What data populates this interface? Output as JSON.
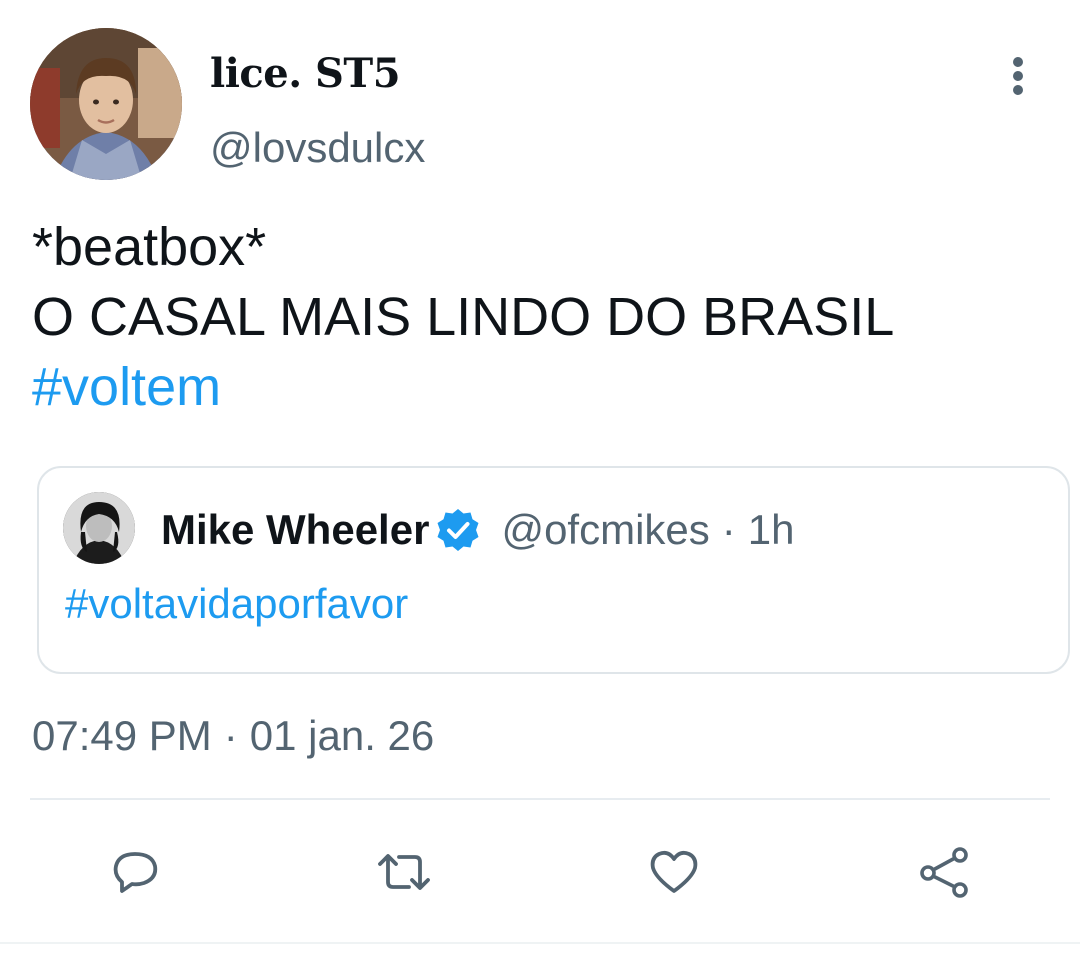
{
  "tweet": {
    "author": {
      "display_name": "lice. ST5",
      "handle": "@lovsdulcx"
    },
    "text_lines": [
      "*beatbox*",
      "O CASAL MAIS LINDO DO BRASIL"
    ],
    "hashtag": "#voltem",
    "quoted": {
      "name": "Mike Wheeler",
      "handle": "@ofcmikes",
      "separator": "·",
      "time": "1h",
      "text": "#voltavidaporfavor",
      "verified": true
    },
    "time": "07:49 PM",
    "separator": "·",
    "date": "01 jan. 26"
  },
  "actions": [
    {
      "icon": "reply-icon"
    },
    {
      "icon": "retweet-icon"
    },
    {
      "icon": "like-icon"
    },
    {
      "icon": "share-icon"
    }
  ],
  "colors": {
    "accent": "#1d9bf0",
    "secondary_text": "#536471",
    "primary_text": "#0f1419",
    "border": "#dfe5e9"
  }
}
